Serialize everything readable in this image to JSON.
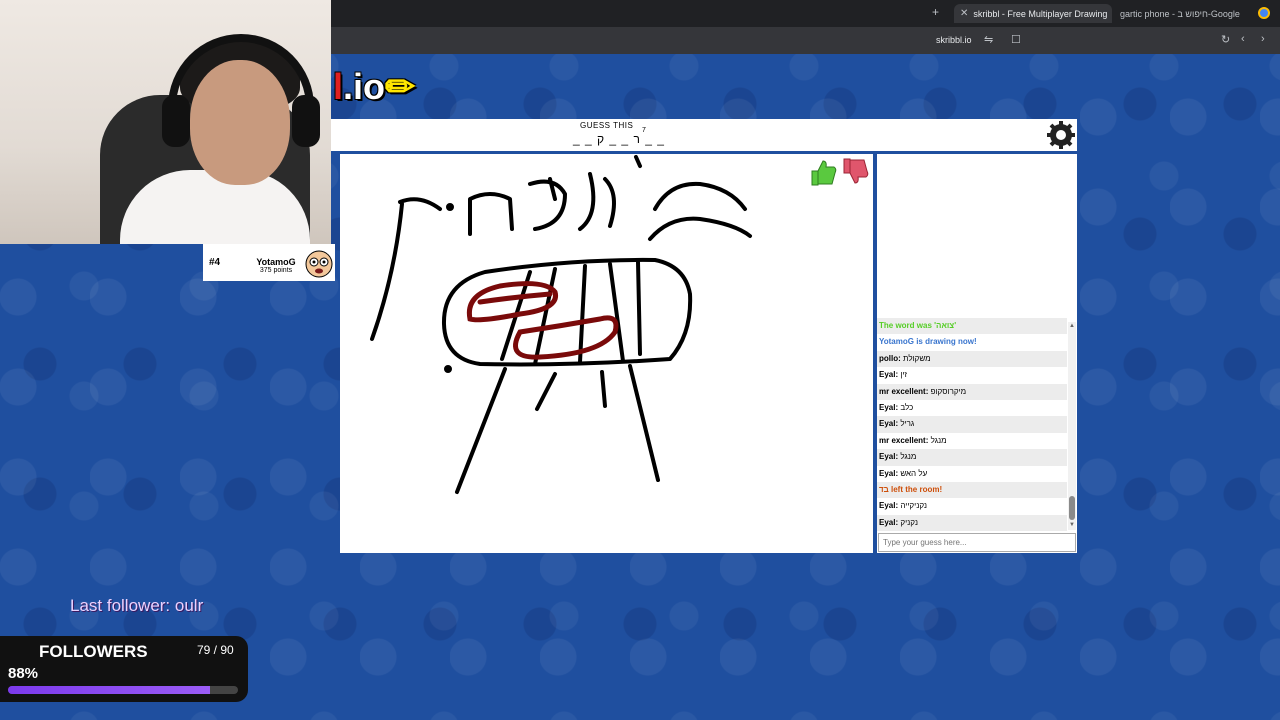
{
  "browser": {
    "active_tab_title": "skribbl - Free Multiplayer Drawing",
    "other_tab_title": "gartic phone - חיפוש ב-Google",
    "url_host": "skribbl.io"
  },
  "logo": {
    "text_l": "l",
    "text_io": ".io"
  },
  "player_card": {
    "rank": "#4",
    "name": "YotamoG",
    "points": "375 points"
  },
  "game": {
    "guess_label": "GUESS THIS",
    "word_hint": "_ _ ר _ _ ק _ _",
    "word_length": "7"
  },
  "chat": {
    "messages": [
      {
        "type": "green",
        "text": "The word was 'צואה'"
      },
      {
        "type": "blue",
        "text": "YotamoG is drawing now!"
      },
      {
        "type": "guess",
        "who": "pollo: ",
        "text": "משקולת"
      },
      {
        "type": "guess",
        "who": "Eyal: ",
        "text": "זין"
      },
      {
        "type": "guess",
        "who": "mr excellent: ",
        "text": "מיקרוסקופ"
      },
      {
        "type": "guess",
        "who": "Eyal: ",
        "text": "כלב"
      },
      {
        "type": "guess",
        "who": "Eyal: ",
        "text": "גריל"
      },
      {
        "type": "guess",
        "who": "mr excellent: ",
        "text": "מנגל"
      },
      {
        "type": "guess",
        "who": "Eyal: ",
        "text": "מנגל"
      },
      {
        "type": "guess",
        "who": "Eyal: ",
        "text": "על האש"
      },
      {
        "type": "left",
        "who": "בד",
        "text": " left the room!"
      },
      {
        "type": "guess",
        "who": "Eyal: ",
        "text": "נקניקייה"
      },
      {
        "type": "guess",
        "who": "Eyal: ",
        "text": "נקניק"
      }
    ],
    "input_placeholder": "Type your guess here..."
  },
  "overlay": {
    "last_follower": "Last follower: oulr",
    "followers_title": "FOLLOWERS",
    "followers_count": "79 / 90",
    "followers_percent": "88%",
    "followers_progress": 0.88
  },
  "icons": {
    "like": "thumbs-up-icon",
    "dislike": "thumbs-down-icon",
    "settings": "gear-icon"
  },
  "colors": {
    "background": "#1f4f9f",
    "like": "#5ac93f",
    "dislike": "#e0566c",
    "progress": "#7c3aed"
  }
}
